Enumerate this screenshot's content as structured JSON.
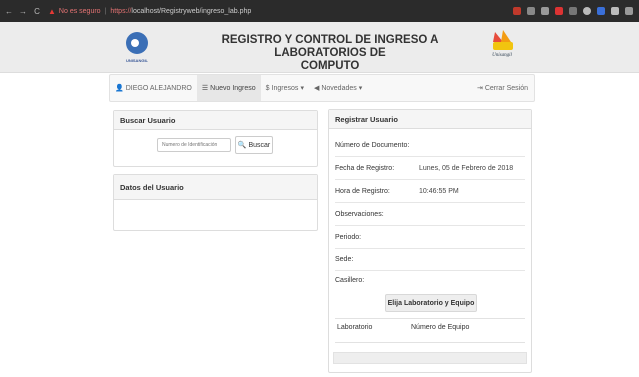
{
  "browser": {
    "insecure_label": "No es seguro",
    "url_scheme": "https://",
    "url_rest": "localhost/Registryweb/ingreso_lab.php"
  },
  "header": {
    "left_logo_text": "UNISANGIL",
    "title_line1": "REGISTRO Y CONTROL DE INGRESO A LABORATORIOS DE",
    "title_line2": "COMPUTO",
    "right_logo_text": "Unisangil"
  },
  "nav": {
    "user_label": "DIEGO ALEJANDRO",
    "nuevo_ingreso_label": "Nuevo Ingreso",
    "ingresos_label": "Ingresos",
    "novedades_label": "Novedades",
    "logout_label": "Cerrar Sesión"
  },
  "buscar": {
    "title": "Buscar Usuario",
    "placeholder": "Numero de Identificación",
    "button_label": "Buscar"
  },
  "datos": {
    "title": "Datos del Usuario"
  },
  "registrar": {
    "title": "Registrar Usuario",
    "rows": [
      {
        "label": "Número de Documento:",
        "value": ""
      },
      {
        "label": "Fecha de Registro:",
        "value": "Lunes, 05 de Febrero de 2018"
      },
      {
        "label": "Hora de Registro:",
        "value": "10:46:55 PM"
      },
      {
        "label": "Observaciones:",
        "value": ""
      },
      {
        "label": "Periodo:",
        "value": ""
      },
      {
        "label": "Sede:",
        "value": ""
      },
      {
        "label": "Casillero:",
        "value": ""
      }
    ],
    "choose_label": "Elija Laboratorio y Equipo",
    "col_lab": "Laboratorio",
    "col_equipo": "Número de Equipo"
  },
  "colors": {
    "chrome_bg": "#2b2b2b",
    "band_bg": "#ececec",
    "panel_head_bg": "#f5f5f5",
    "insecure_red": "#e53935"
  },
  "icons": {
    "back": "arrow-left-icon",
    "forward": "arrow-right-icon",
    "reload": "reload-icon",
    "warning": "warning-triangle-icon",
    "user": "user-icon",
    "list": "list-icon",
    "usd": "dollar-icon",
    "bullhorn": "bullhorn-icon",
    "logout": "logout-icon",
    "search": "search-icon"
  }
}
